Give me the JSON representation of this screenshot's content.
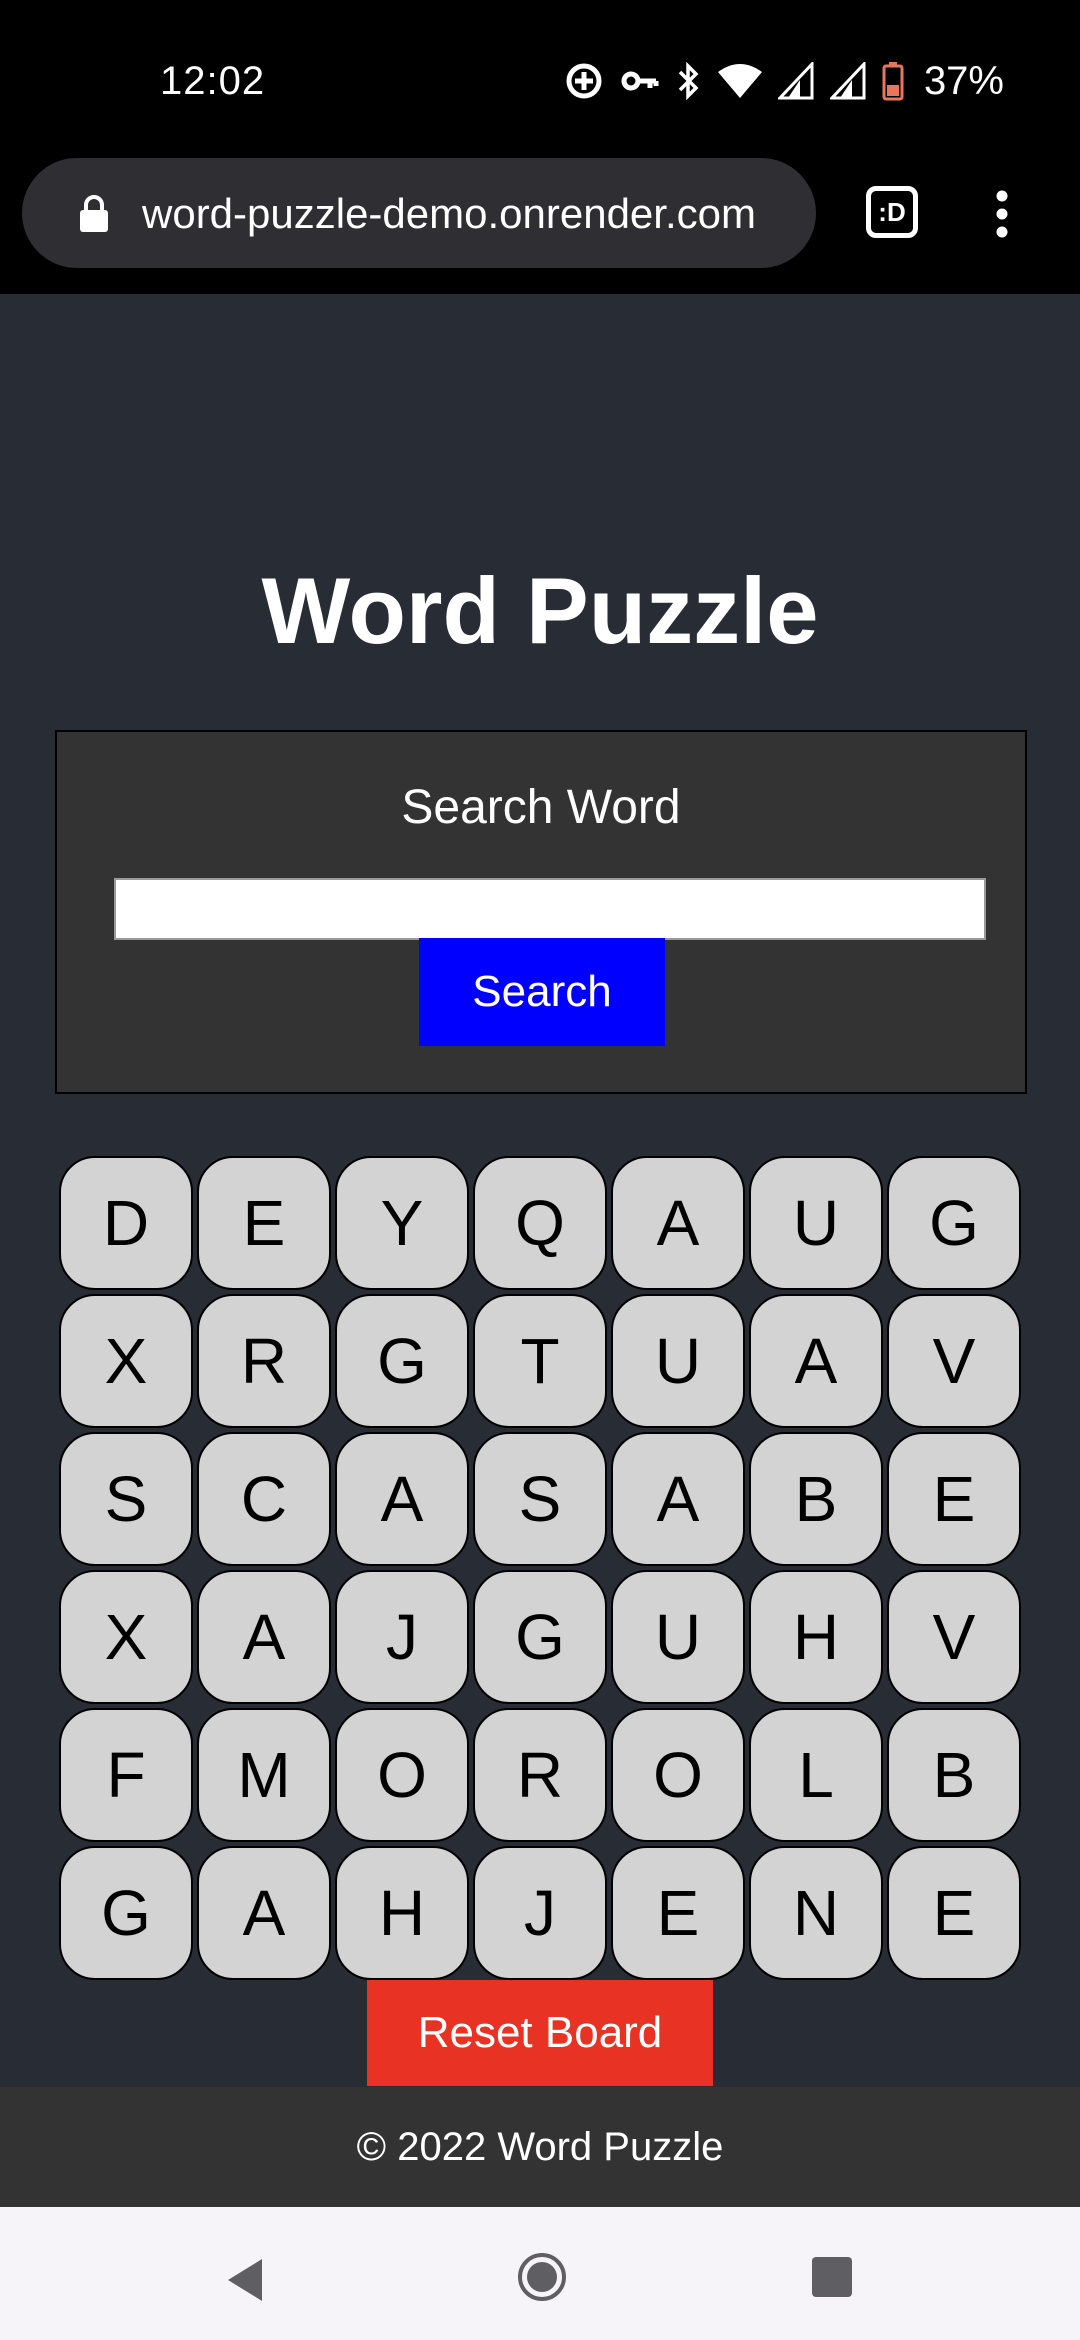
{
  "status_bar": {
    "time": "12:02",
    "battery": "37%",
    "icons": [
      "data-saver-icon",
      "vpn-key-icon",
      "bluetooth-icon",
      "wifi-icon",
      "signal-icon",
      "signal-icon-2",
      "battery-icon"
    ]
  },
  "browser": {
    "url": "word-puzzle-demo.onrender.com",
    "tab_label": ":D"
  },
  "page": {
    "title": "Word Puzzle",
    "search": {
      "label": "Search Word",
      "input_value": "",
      "button_label": "Search"
    },
    "board": [
      [
        "D",
        "E",
        "Y",
        "Q",
        "A",
        "U",
        "G"
      ],
      [
        "X",
        "R",
        "G",
        "T",
        "U",
        "A",
        "V"
      ],
      [
        "S",
        "C",
        "A",
        "S",
        "A",
        "B",
        "E"
      ],
      [
        "X",
        "A",
        "J",
        "G",
        "U",
        "H",
        "V"
      ],
      [
        "F",
        "M",
        "O",
        "R",
        "O",
        "L",
        "B"
      ],
      [
        "G",
        "A",
        "H",
        "J",
        "E",
        "N",
        "E"
      ]
    ],
    "reset_label": "Reset Board",
    "footer": "© 2022 Word Puzzle"
  },
  "colors": {
    "page_bg": "#282c35",
    "panel_bg": "#333333",
    "search_button": "#0000ff",
    "reset_button": "#e83224",
    "cell_bg": "#d3d3d3"
  }
}
